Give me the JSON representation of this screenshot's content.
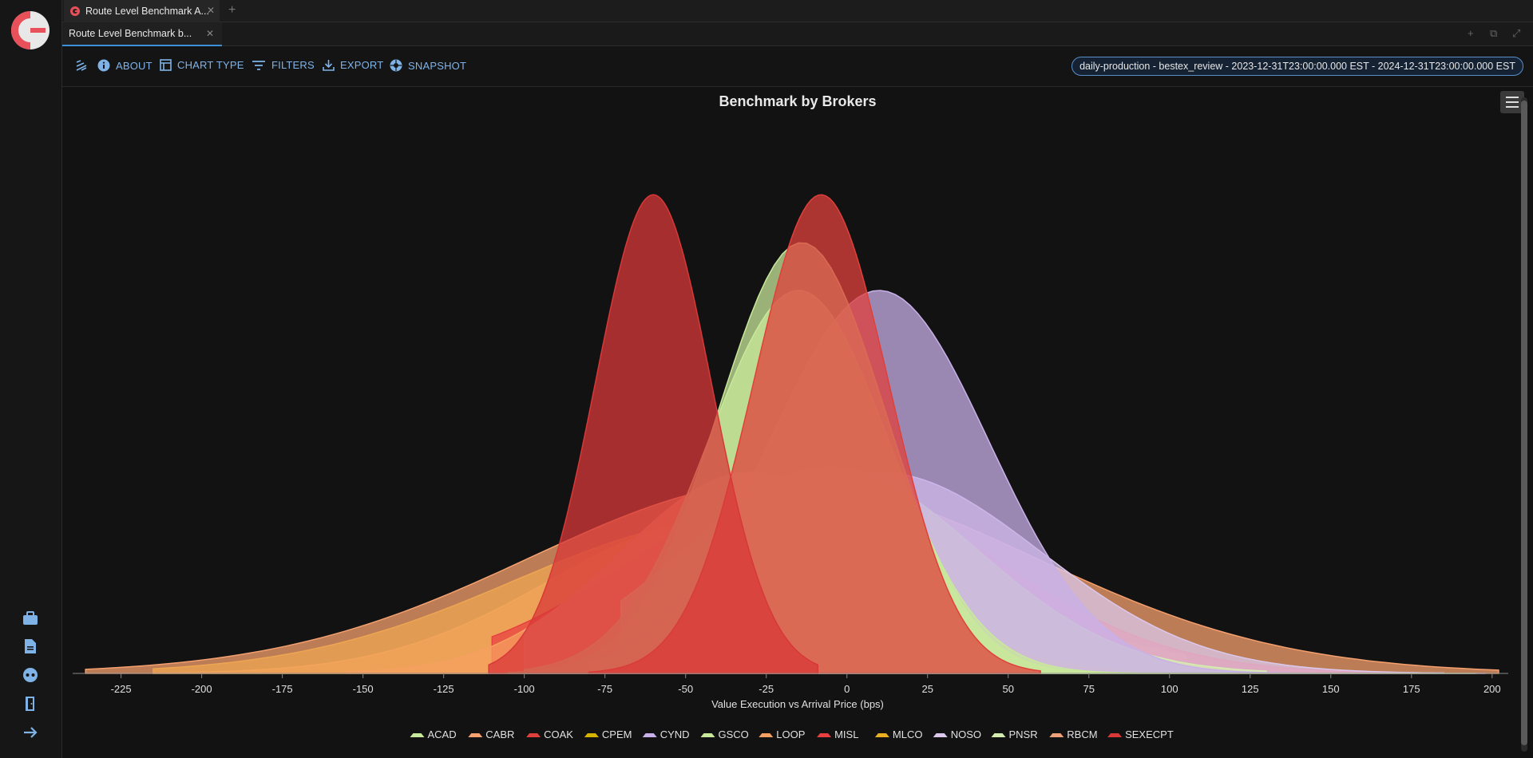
{
  "tabs": {
    "outer_tab_title": "Route Level Benchmark A...",
    "inner_tab_title": "Route Level Benchmark b..."
  },
  "toolbar": {
    "about": "ABOUT",
    "chart_type": "CHART TYPE",
    "filters": "FILTERS",
    "export": "EXPORT",
    "snapshot": "SNAPSHOT",
    "context": "daily-production - bestex_review - 2023-12-31T23:00:00.000 EST - 2024-12-31T23:00:00.000 EST"
  },
  "rail_icons": [
    "briefcase-icon",
    "document-icon",
    "robot-icon",
    "exit-door-icon",
    "arrow-right-icon"
  ],
  "colors": {
    "accent": "#7fb3e8",
    "background": "#121212"
  },
  "chart_data": {
    "type": "area",
    "title": "Benchmark by Brokers",
    "xlabel": "Value Execution vs Arrival Price (bps)",
    "ylabel": "",
    "xlim": [
      -240,
      205
    ],
    "x_ticks": [
      "-225",
      "-200",
      "-175",
      "-150",
      "-125",
      "-100",
      "-75",
      "-50",
      "-25",
      "0",
      "25",
      "50",
      "75",
      "100",
      "125",
      "150",
      "175",
      "200"
    ],
    "legend_position": "bottom-center",
    "series": [
      {
        "name": "ACAD",
        "color": "#c8e89a",
        "mean": -14,
        "sd": 26,
        "peak": 0.9,
        "min": -105,
        "max": 195
      },
      {
        "name": "CABR",
        "color": "#f5a06e",
        "mean": -20,
        "sd": 78,
        "peak": 0.4,
        "min": -236,
        "max": 202
      },
      {
        "name": "COAK",
        "color": "#e0403c",
        "mean": -8,
        "sd": 21,
        "peak": 1.0,
        "min": -80,
        "max": 60
      },
      {
        "name": "CPEM",
        "color": "#d4b400",
        "mean": -35,
        "sd": 68,
        "peak": 0.32,
        "min": -215,
        "max": 105
      },
      {
        "name": "CYND",
        "color": "#c8b0e8",
        "mean": 10,
        "sd": 34,
        "peak": 0.8,
        "min": -80,
        "max": 198
      },
      {
        "name": "GSCO",
        "color": "#c8e89a",
        "mean": -15,
        "sd": 28,
        "peak": 0.8,
        "min": -100,
        "max": 120
      },
      {
        "name": "LOOP",
        "color": "#f5a060",
        "mean": -30,
        "sd": 40,
        "peak": 0.42,
        "min": -155,
        "max": 75
      },
      {
        "name": "MISL",
        "color": "#e84040",
        "mean": -10,
        "sd": 55,
        "peak": 0.4,
        "min": -110,
        "max": 178
      },
      {
        "name": "MLCO",
        "color": "#e8b020",
        "mean": -40,
        "sd": 52,
        "peak": 0.32,
        "min": -215,
        "max": 105
      },
      {
        "name": "NOSO",
        "color": "#dcc8ec",
        "mean": 10,
        "sd": 50,
        "peak": 0.42,
        "min": -60,
        "max": 185
      },
      {
        "name": "PNSR",
        "color": "#d4ecb0",
        "mean": -5,
        "sd": 45,
        "peak": 0.43,
        "min": -70,
        "max": 130
      },
      {
        "name": "RBCM",
        "color": "#f0a078",
        "mean": -30,
        "sd": 40,
        "peak": 0.42,
        "min": -100,
        "max": 180
      },
      {
        "name": "SEXECPT",
        "color": "#d83838",
        "mean": -60,
        "sd": 18,
        "peak": 1.0,
        "min": -111,
        "max": -9
      }
    ]
  }
}
